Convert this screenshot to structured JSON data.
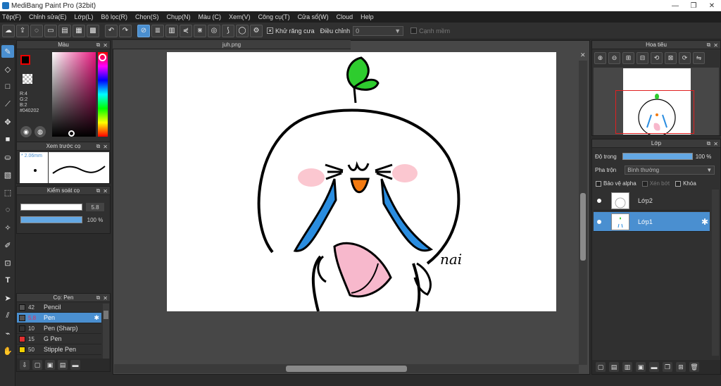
{
  "window": {
    "title": "MediBang Paint Pro (32bit)",
    "minimize": "—",
    "maximize": "❐",
    "close": "✕"
  },
  "menu": [
    "Tệp(F)",
    "Chỉnh sửa(E)",
    "Lớp(L)",
    "Bộ lọc(R)",
    "Chọn(S)",
    "Chụp(N)",
    "Màu (C)",
    "Xem(V)",
    "Công cụ(T)",
    "Cửa sổ(W)",
    "Cloud",
    "Help"
  ],
  "toolbar": {
    "antialias_label": "Khử răng cưa",
    "antialias_checked": "✕",
    "correction_label": "Điều chỉnh",
    "correction_value": "0",
    "correction_arrow": "▼",
    "edge_label": "Cạnh mềm"
  },
  "color_panel": {
    "title": "Màu",
    "r": "R:4",
    "g": "G:2",
    "b": "B:2",
    "hex": "#040202",
    "fg_color": "#040202",
    "accent_color": "#e8197f"
  },
  "preview_panel": {
    "title": "Xem trước cọ",
    "size": "* 2.06mm"
  },
  "control_panel": {
    "title": "Kiểm soát cọ",
    "size_value": "5.8",
    "size_fill": 0.98,
    "opacity_value": "100 %",
    "opacity_fill": 1.0
  },
  "brush_panel": {
    "title": "Cọ: Pen",
    "brushes": [
      {
        "size": "42",
        "name": "Pencil",
        "color": "#555555"
      },
      {
        "size": "5.8",
        "name": "Pen",
        "color": "#555555",
        "active": true
      },
      {
        "size": "10",
        "name": "Pen (Sharp)",
        "color": "#333333"
      },
      {
        "size": "15",
        "name": "G Pen",
        "color": "#e03030"
      },
      {
        "size": "50",
        "name": "Stipple Pen",
        "color": "#f0d000"
      }
    ]
  },
  "document": {
    "tab_name": "juh.png",
    "signature": "nai"
  },
  "navigator": {
    "title": "Hoa tiêu"
  },
  "layer_panel": {
    "title": "Lớp",
    "opacity_label": "Độ trong",
    "opacity_value": "100 %",
    "opacity_fill": 1.0,
    "blend_label": "Pha trộn",
    "blend_value": "Bình thường",
    "blend_arrow": "▼",
    "protect_alpha": "Bảo vệ alpha",
    "clipping": "Xén bớt",
    "lock": "Khóa",
    "layers": [
      {
        "name": "Lớp2",
        "active": false
      },
      {
        "name": "Lớp1",
        "active": true
      }
    ]
  },
  "icons": {
    "panel_undock": "⧉",
    "panel_close": "✕",
    "gear": "✱"
  }
}
